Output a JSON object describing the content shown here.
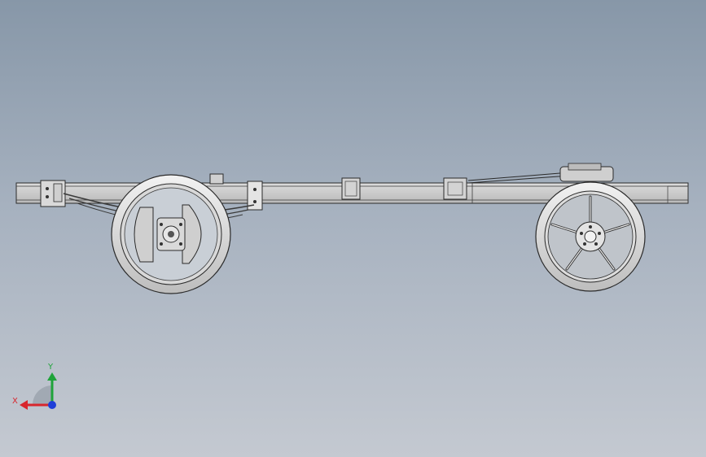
{
  "viewport": {
    "background_top": "#8797a8",
    "background_bottom": "#c4c9d1"
  },
  "model": {
    "parts": [
      "chassis-frame",
      "front-wheel",
      "rear-wheel",
      "leaf-spring",
      "mounting-brackets"
    ]
  },
  "triad": {
    "x_label": "X",
    "y_label": "Y",
    "x_color": "#d8262d",
    "y_color": "#1fa33a",
    "z_color": "#1f3fd8"
  }
}
